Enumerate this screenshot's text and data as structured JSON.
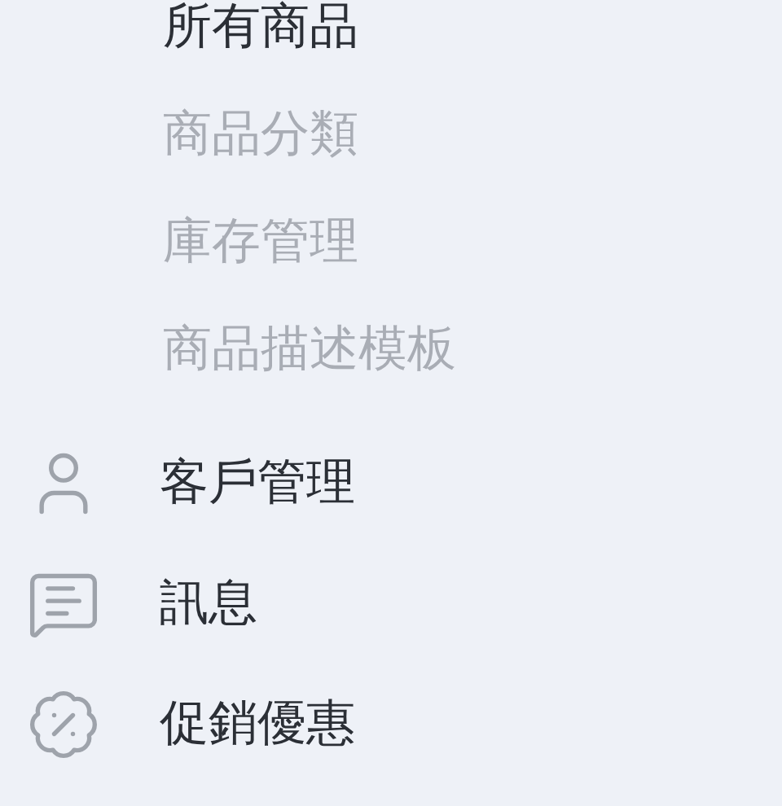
{
  "submenu": [
    {
      "label": "所有商品",
      "selected": true
    },
    {
      "label": "商品分類",
      "selected": false
    },
    {
      "label": "庫存管理",
      "selected": false
    },
    {
      "label": "商品描述模板",
      "selected": false
    }
  ],
  "menu": [
    {
      "label": "客戶管理"
    },
    {
      "label": "訊息"
    },
    {
      "label": "促銷優惠"
    }
  ]
}
